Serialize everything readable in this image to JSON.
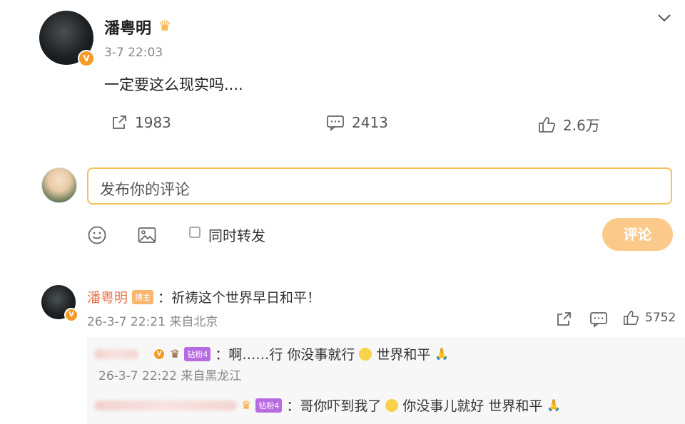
{
  "post": {
    "author": "潘粤明",
    "time": "3-7 22:03",
    "text": "一定要这么现实吗....",
    "repost_count": "1983",
    "comment_count": "2413",
    "like_count": "2.6万"
  },
  "composer": {
    "placeholder": "发布你的评论",
    "repost_label": "同时转发",
    "submit_label": "评论"
  },
  "comments": [
    {
      "author": "潘粤明",
      "tag": "博主",
      "text": "：祈祷这个世界早日和平！",
      "meta": "26-3-7 22:21 来自北京",
      "like_count": "5752",
      "replies": [
        {
          "tag": "钻粉4",
          "text": "：啊……行 你没事就行",
          "text_tail": "世界和平",
          "meta": "26-3-7 22:22 来自黑龙江"
        },
        {
          "tag": "钻粉4",
          "text": "：哥你吓到我了",
          "text_tail": "你没事儿就好 世界和平"
        }
      ]
    }
  ],
  "colors": {
    "accent_orange": "#eb7350",
    "input_border": "#f2c15a",
    "submit_button": "#fbc98a",
    "verified_badge": "#f59a23"
  }
}
